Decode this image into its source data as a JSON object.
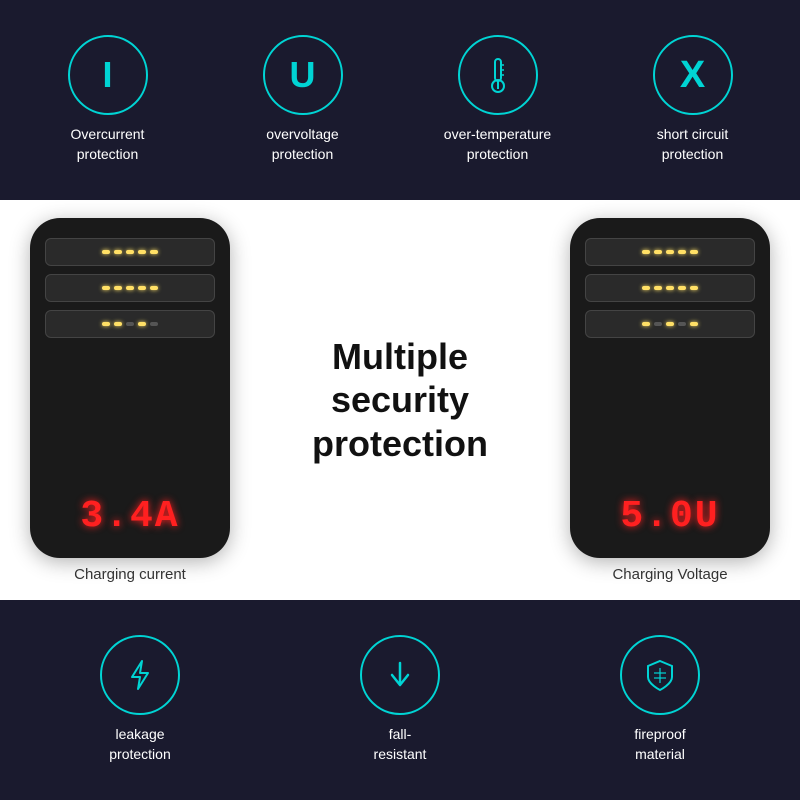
{
  "top": {
    "features": [
      {
        "id": "overcurrent",
        "icon_symbol": "I",
        "icon_type": "letter",
        "label_line1": "Overcurrent",
        "label_line2": "protection"
      },
      {
        "id": "overvoltage",
        "icon_symbol": "U",
        "icon_type": "letter",
        "label_line1": "overvoltage",
        "label_line2": "protection"
      },
      {
        "id": "over-temperature",
        "icon_symbol": "thermometer",
        "icon_type": "svg",
        "label_line1": "over-temperature",
        "label_line2": "protection"
      },
      {
        "id": "short-circuit",
        "icon_symbol": "X",
        "icon_type": "letter",
        "label_line1": "short circuit",
        "label_line2": "protection"
      }
    ]
  },
  "middle": {
    "left_card": {
      "display_value": "3.4A",
      "label": "Charging current",
      "usb_count": 3
    },
    "right_card": {
      "display_value": "5.0U",
      "label": "Charging Voltage",
      "usb_count": 3
    },
    "center_text_line1": "Multiple",
    "center_text_line2": "security",
    "center_text_line3": "protection"
  },
  "bottom": {
    "features": [
      {
        "id": "leakage",
        "icon_type": "lightning",
        "label_line1": "leakage",
        "label_line2": "protection"
      },
      {
        "id": "fall-resistant",
        "icon_type": "arrow-down",
        "label_line1": "fall-",
        "label_line2": "resistant"
      },
      {
        "id": "fireproof",
        "icon_type": "shield",
        "label_line1": "fireproof",
        "label_line2": "material"
      }
    ]
  }
}
